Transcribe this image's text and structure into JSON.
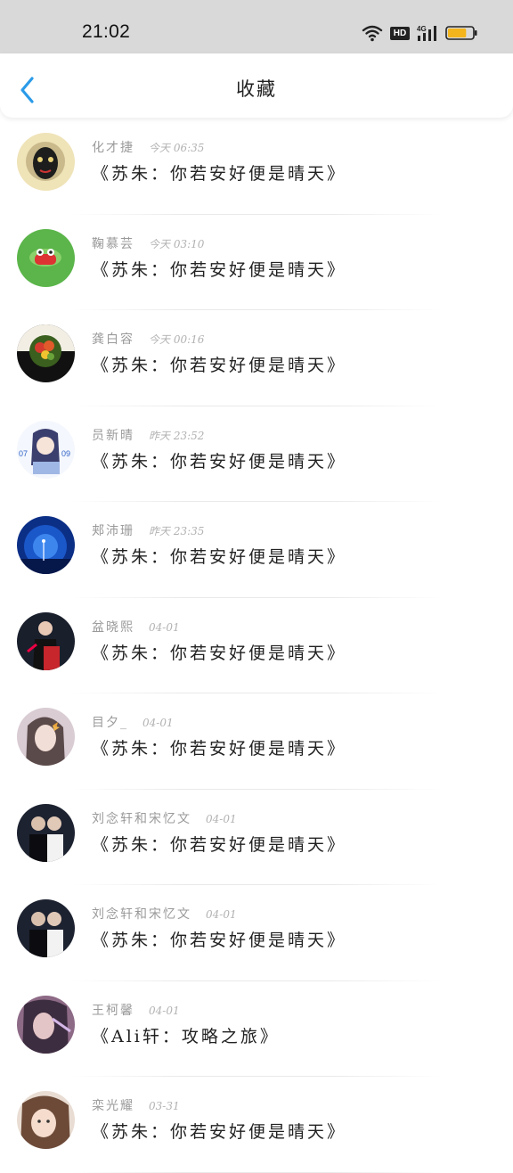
{
  "status_bar": {
    "time": "21:02",
    "icons": [
      "wifi-icon",
      "hd-icon",
      "signal-4g-icon",
      "battery-icon"
    ],
    "hd_label": "HD",
    "network_label": "4G",
    "battery_level": 0.75,
    "battery_color": "#f3b51b"
  },
  "header": {
    "title": "收藏",
    "back_icon": "chevron-left-icon",
    "accent_color": "#2a9be8"
  },
  "items": [
    {
      "name": "化才捷",
      "time": "今天 06:35",
      "title": "《苏朱：你若安好便是晴天》"
    },
    {
      "name": "鞠慕芸",
      "time": "今天 03:10",
      "title": "《苏朱：你若安好便是晴天》"
    },
    {
      "name": "龚白容",
      "time": "今天 00:16",
      "title": "《苏朱：你若安好便是晴天》"
    },
    {
      "name": "员新晴",
      "time": "昨天 23:52",
      "title": "《苏朱：你若安好便是晴天》"
    },
    {
      "name": "郏沛珊",
      "time": "昨天 23:35",
      "title": "《苏朱：你若安好便是晴天》"
    },
    {
      "name": "盆晓熙",
      "time": "04-01",
      "title": "《苏朱：你若安好便是晴天》"
    },
    {
      "name": "目夕_",
      "time": "04-01",
      "title": "《苏朱：你若安好便是晴天》"
    },
    {
      "name": "刘念轩和宋忆文",
      "time": "04-01",
      "title": "《苏朱：你若安好便是晴天》"
    },
    {
      "name": "刘念轩和宋忆文",
      "time": "04-01",
      "title": "《苏朱：你若安好便是晴天》"
    },
    {
      "name": "王柯馨",
      "time": "04-01",
      "title": "《Ali轩：攻略之旅》"
    },
    {
      "name": "栾光耀",
      "time": "03-31",
      "title": "《苏朱：你若安好便是晴天》"
    }
  ]
}
